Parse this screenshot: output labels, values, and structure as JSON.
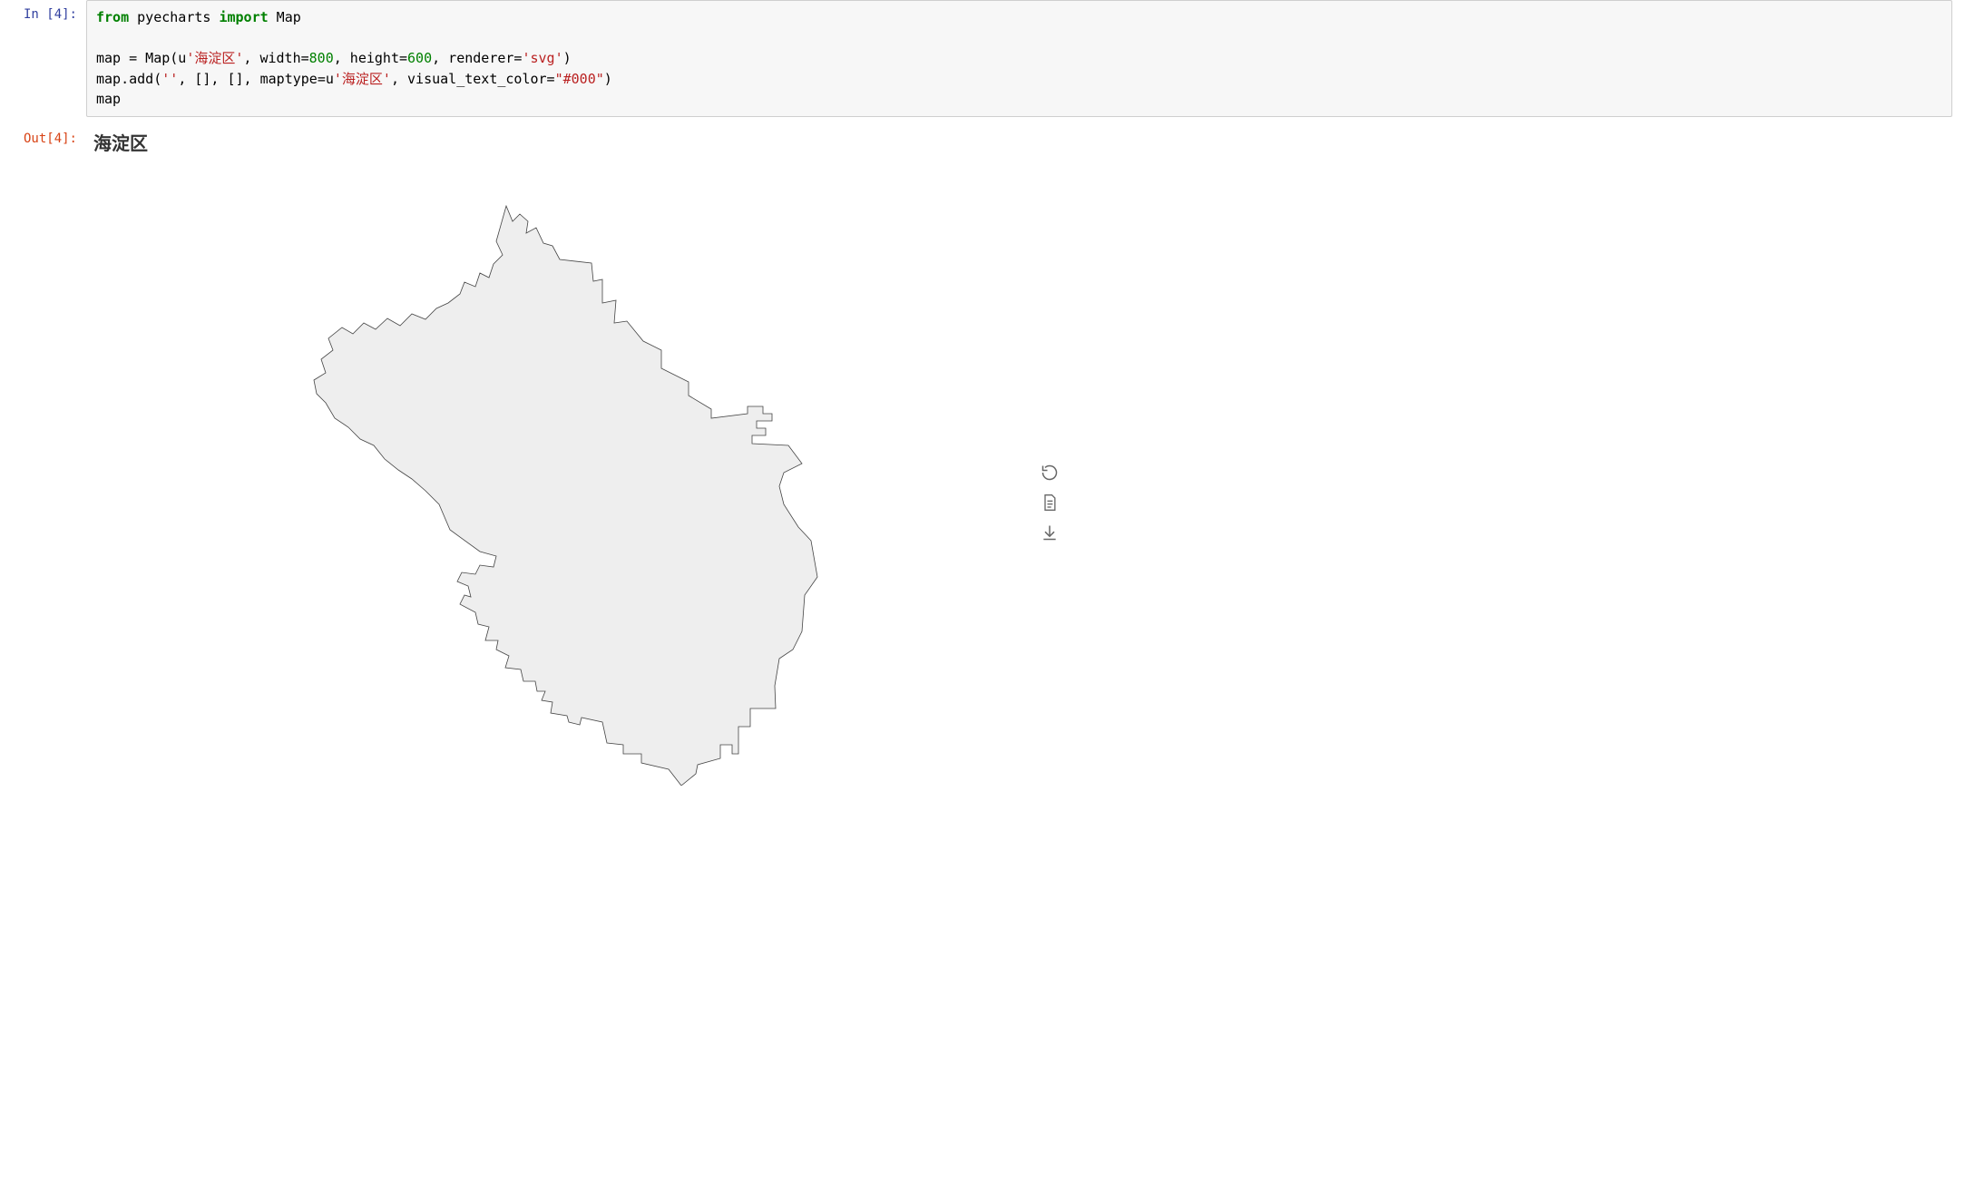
{
  "cell": {
    "in_prompt": "In [4]:",
    "out_prompt": "Out[4]:",
    "code": {
      "line1": {
        "from": "from",
        "pkg": " pyecharts ",
        "import": "import",
        "cls": " Map"
      },
      "line2_a": "map = Map(u",
      "line2_str1": "'海淀区'",
      "line2_b": ", width=",
      "line2_num1": "800",
      "line2_c": ", height=",
      "line2_num2": "600",
      "line2_d": ", renderer=",
      "line2_str2": "'svg'",
      "line2_e": ")",
      "line3_a": "map.add(",
      "line3_str1": "''",
      "line3_b": ", [], [], maptype=u",
      "line3_str2": "'海淀区'",
      "line3_c": ", visual_text_color=",
      "line3_str3": "\"#000\"",
      "line3_d": ")",
      "line4": "map"
    }
  },
  "output": {
    "map_title": "海淀区"
  }
}
